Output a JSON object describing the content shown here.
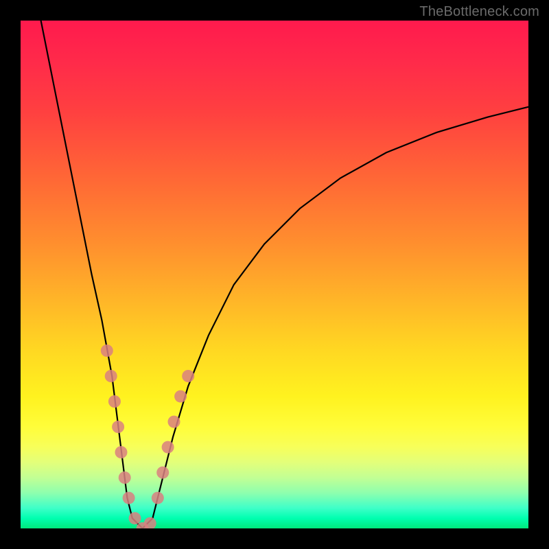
{
  "watermark": "TheBottleneck.com",
  "chart_data": {
    "type": "line",
    "title": "",
    "xlabel": "",
    "ylabel": "",
    "xlim": [
      0,
      100
    ],
    "ylim": [
      0,
      100
    ],
    "grid": false,
    "legend": false,
    "series": [
      {
        "name": "bottleneck-curve",
        "x": [
          4,
          6,
          8,
          10,
          12,
          14,
          16,
          18,
          19,
          20,
          21,
          22,
          24,
          26,
          28,
          30,
          33,
          37,
          42,
          48,
          55,
          63,
          72,
          82,
          92,
          100
        ],
        "y": [
          100,
          90,
          80,
          70,
          60,
          50,
          41,
          30,
          22,
          14,
          6,
          2,
          0,
          2,
          10,
          18,
          28,
          38,
          48,
          56,
          63,
          69,
          74,
          78,
          81,
          83
        ],
        "color": "#000000"
      }
    ],
    "markers": [
      {
        "name": "highlight-dots",
        "color": "#d98080",
        "points": [
          {
            "x": 17.0,
            "y": 35
          },
          {
            "x": 17.8,
            "y": 30
          },
          {
            "x": 18.5,
            "y": 25
          },
          {
            "x": 19.2,
            "y": 20
          },
          {
            "x": 19.8,
            "y": 15
          },
          {
            "x": 20.5,
            "y": 10
          },
          {
            "x": 21.3,
            "y": 6
          },
          {
            "x": 22.5,
            "y": 2
          },
          {
            "x": 24.0,
            "y": 0
          },
          {
            "x": 25.5,
            "y": 1
          },
          {
            "x": 27.0,
            "y": 6
          },
          {
            "x": 28.0,
            "y": 11
          },
          {
            "x": 29.0,
            "y": 16
          },
          {
            "x": 30.2,
            "y": 21
          },
          {
            "x": 31.5,
            "y": 26
          },
          {
            "x": 33.0,
            "y": 30
          }
        ]
      }
    ],
    "background_gradient": {
      "direction": "vertical",
      "stops": [
        {
          "pos": 0.0,
          "color": "#ff1a4d"
        },
        {
          "pos": 0.5,
          "color": "#ffc225"
        },
        {
          "pos": 0.8,
          "color": "#fffd3a"
        },
        {
          "pos": 1.0,
          "color": "#00e87c"
        }
      ]
    }
  }
}
